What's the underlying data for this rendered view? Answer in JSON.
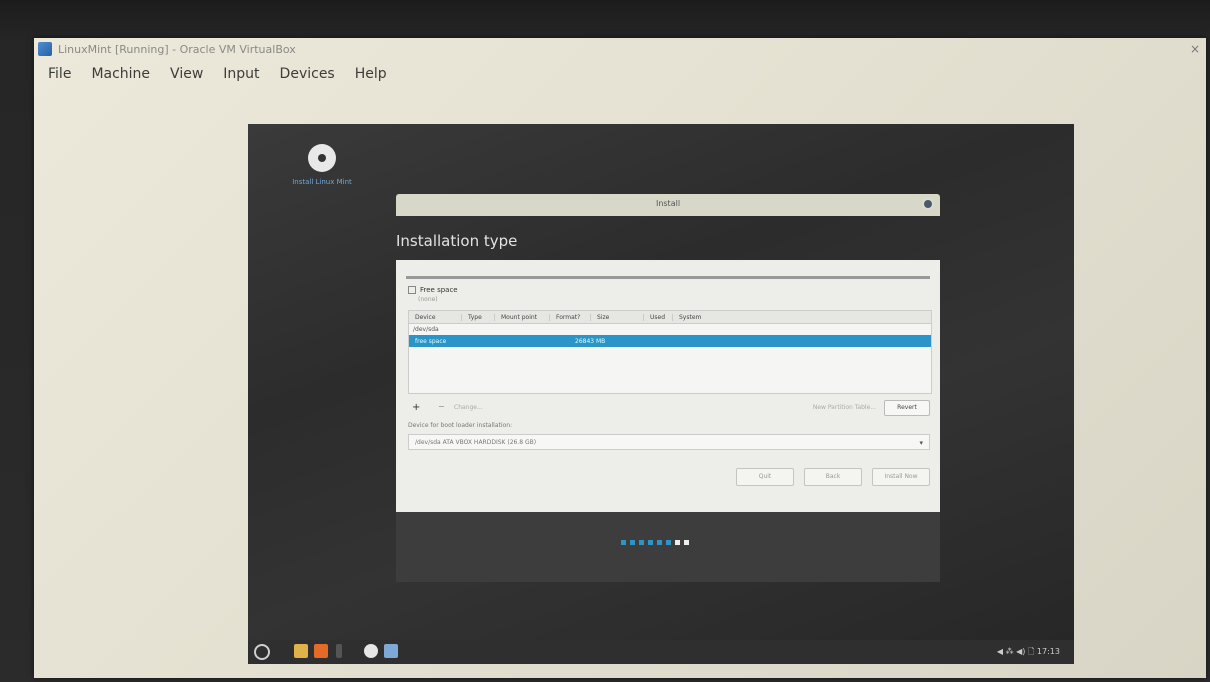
{
  "vbox": {
    "title": "LinuxMint [Running] - Oracle VM VirtualBox",
    "close_glyph": "×",
    "menu": [
      "File",
      "Machine",
      "View",
      "Input",
      "Devices",
      "Help"
    ]
  },
  "desktop": {
    "shortcut_label": "Install Linux Mint"
  },
  "installer": {
    "window_title": "Install",
    "page_title": "Installation type",
    "free_space": {
      "label": "Free space",
      "sub": "(none)"
    },
    "table": {
      "columns": [
        "Device",
        "Type",
        "Mount point",
        "Format?",
        "Size",
        "Used",
        "System"
      ],
      "device": "/dev/sda",
      "selected_row": {
        "name": "free space",
        "size": "26843 MB"
      }
    },
    "tools": {
      "add": "+",
      "remove": "−",
      "change": "Change...",
      "new_table": "New Partition Table...",
      "revert": "Revert"
    },
    "boot_loader": {
      "label": "Device for boot loader installation:",
      "value": "/dev/sda ATA VBOX HARDDISK (26.8 GB)",
      "arrow": "▾"
    },
    "buttons": {
      "quit": "Quit",
      "back": "Back",
      "install_now": "Install Now"
    },
    "progress": {
      "steps_done": 6,
      "steps_total": 8
    }
  },
  "panel": {
    "tray_text": "◀ ⁂ ◀) 🗋 17:13"
  },
  "colors": {
    "accent": "#2b95c9",
    "desktop": "#2c2c2c",
    "window_bg": "#ededea"
  }
}
